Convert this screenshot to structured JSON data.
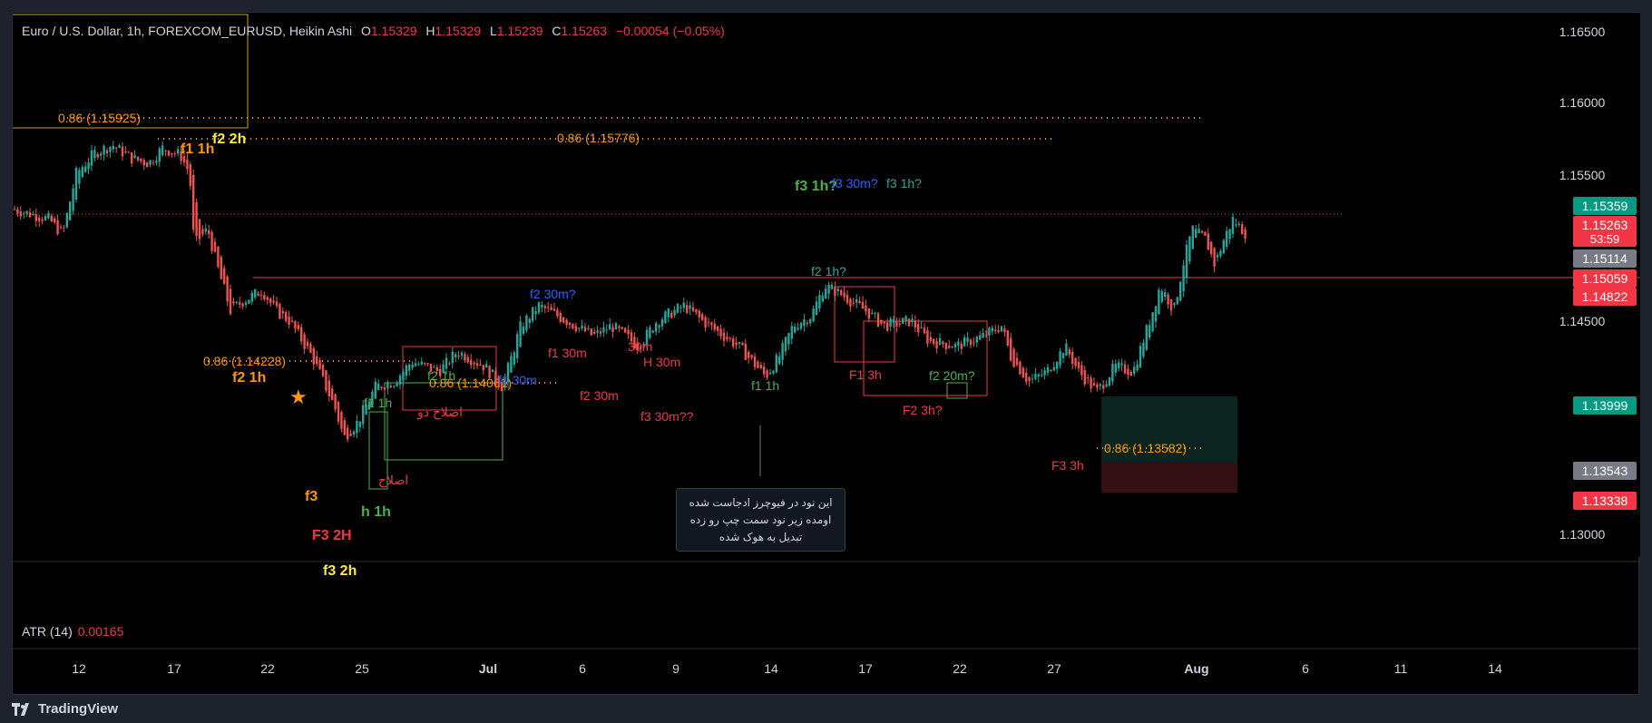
{
  "legend": {
    "symbol": "Euro / U.S. Dollar, 1h, FOREXCOM_EURUSD, Heikin Ashi",
    "o_label": "O",
    "o_value": "1.15329",
    "h_label": "H",
    "h_value": "1.15329",
    "l_label": "L",
    "l_value": "1.15239",
    "c_label": "C",
    "c_value": "1.15263",
    "change": "−0.00054 (−0.05%)"
  },
  "indicator": {
    "name": "ATR (14)",
    "value": "0.00165"
  },
  "brand": {
    "name": "TradingView"
  },
  "colors": {
    "bg": "#000000",
    "up": "#26a69a",
    "down": "#ef5350",
    "orange": "#ff9800",
    "yellow": "#ffeb3b",
    "green": "#4caf50",
    "blue": "#2962ff",
    "red": "#f23645"
  },
  "price_axis": [
    "1.16500",
    "1.16000",
    "1.15500",
    "1.14500",
    "1.13000"
  ],
  "time_axis": [
    "12",
    "17",
    "22",
    "25",
    "Jul",
    "6",
    "9",
    "14",
    "17",
    "22",
    "27",
    "Aug",
    "6",
    "11",
    "14"
  ],
  "price_tags": [
    {
      "label": "1.15359",
      "color": "#089981"
    },
    {
      "label": "1.15263",
      "color": "#f23645",
      "sub": "53:59"
    },
    {
      "label": "1.15114",
      "color": "#787b86"
    },
    {
      "label": "1.15059",
      "color": "#f23645"
    },
    {
      "label": "1.14822",
      "color": "#f23645"
    },
    {
      "label": "1.13999",
      "color": "#089981"
    },
    {
      "label": "1.13543",
      "color": "#787b86"
    },
    {
      "label": "1.13338",
      "color": "#f23645"
    }
  ],
  "fib_labels": [
    "0.86 (1.15925)",
    "0.86 (1.15776)",
    "0.86 (1.14228)",
    "0.86 (1.14061)",
    "0.86 (1.13582)"
  ],
  "annotations": [
    {
      "text": "f2 2h",
      "color": "#ffeb3b",
      "bold": true
    },
    {
      "text": "f1 1h",
      "color": "#ff9800",
      "bold": true
    },
    {
      "text": "f2 1h",
      "color": "#ff9800",
      "bold": true
    },
    {
      "text": "f3",
      "color": "#ff9800",
      "bold": true
    },
    {
      "text": "F3 2H",
      "color": "#f23645",
      "bold": true
    },
    {
      "text": "f3 2h",
      "color": "#ffeb3b",
      "bold": true
    },
    {
      "text": "h 1h",
      "color": "#4caf50",
      "bold": true
    },
    {
      "text": "f1 1h",
      "color": "#4caf50",
      "bold": false
    },
    {
      "text": "f2 1h",
      "color": "#4caf50",
      "bold": false
    },
    {
      "text": "f1 30m",
      "color": "#2962ff",
      "bold": false
    },
    {
      "text": "f2 30m?",
      "color": "#2962ff",
      "bold": false
    },
    {
      "text": "f1 30m",
      "color": "#f23645",
      "bold": false
    },
    {
      "text": "30m",
      "color": "#f23645",
      "bold": false
    },
    {
      "text": "H 30m",
      "color": "#f23645",
      "bold": false
    },
    {
      "text": "f2 30m",
      "color": "#f23645",
      "bold": false
    },
    {
      "text": "f3 30m??",
      "color": "#f23645",
      "bold": false
    },
    {
      "text": "f1 1h",
      "color": "#4caf50",
      "bold": false
    },
    {
      "text": "f3 1h?",
      "color": "#4caf50",
      "bold": true
    },
    {
      "text": "f3 30m?",
      "color": "#2962ff",
      "bold": false
    },
    {
      "text": "f3 1h?",
      "color": "#26a69a",
      "bold": false
    },
    {
      "text": "f2 1h?",
      "color": "#26a69a",
      "bold": false
    },
    {
      "text": "F1 3h",
      "color": "#f23645",
      "bold": false
    },
    {
      "text": "F2 3h?",
      "color": "#f23645",
      "bold": false
    },
    {
      "text": "f2 20m?",
      "color": "#4caf50",
      "bold": false
    },
    {
      "text": "F3 3h",
      "color": "#f23645",
      "bold": false
    },
    {
      "text": "اصلاح",
      "color": "#f23645",
      "bold": false
    },
    {
      "text": "اصلاح دو",
      "color": "#f23645",
      "bold": false
    }
  ],
  "note": {
    "line1": "این نود در فیوچرز ادجاست شده",
    "line2": "اومده زیر نود سمت چپ رو زده",
    "line3": "تبدیل به هوک شده"
  }
}
